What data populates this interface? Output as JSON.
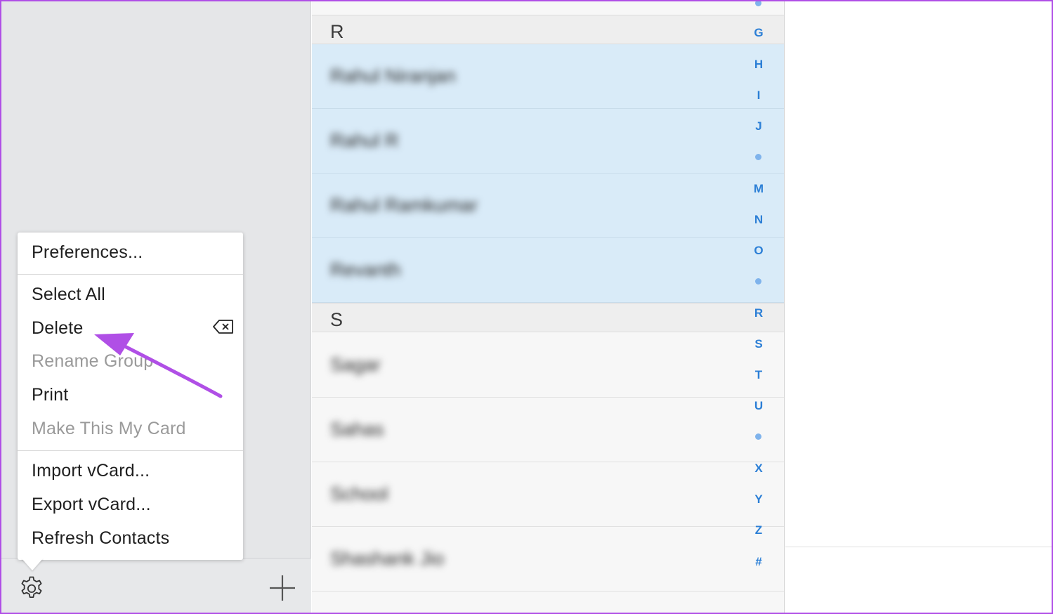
{
  "groups_pane": {
    "toolbar": {
      "settings_icon": "gear-icon",
      "add_icon": "plus-icon"
    }
  },
  "menu": {
    "items": [
      {
        "label": "Preferences...",
        "enabled": true
      },
      {
        "label": "Select All",
        "enabled": true
      },
      {
        "label": "Delete",
        "enabled": true,
        "shortcut_icon": "delete-key-icon"
      },
      {
        "label": "Rename Group",
        "enabled": false
      },
      {
        "label": "Print",
        "enabled": true
      },
      {
        "label": "Make This My Card",
        "enabled": false
      },
      {
        "label": "Import vCard...",
        "enabled": true
      },
      {
        "label": "Export vCard...",
        "enabled": true
      },
      {
        "label": "Refresh Contacts",
        "enabled": true
      }
    ]
  },
  "contacts": {
    "sections": [
      {
        "letter": "R",
        "rows": [
          {
            "name": "Rahul Niranjan",
            "selected": true
          },
          {
            "name": "Rahul R",
            "selected": true
          },
          {
            "name": "Rahul Ramkumar",
            "selected": true
          },
          {
            "name": "Revanth",
            "selected": true
          }
        ]
      },
      {
        "letter": "S",
        "rows": [
          {
            "name": "Sagar",
            "selected": false
          },
          {
            "name": "Sahas",
            "selected": false
          },
          {
            "name": "School",
            "selected": false
          },
          {
            "name": "Shashank Jio",
            "selected": false
          }
        ]
      }
    ],
    "index": [
      "G",
      "H",
      "I",
      "J",
      "•",
      "M",
      "N",
      "O",
      "•",
      "R",
      "S",
      "T",
      "U",
      "•",
      "X",
      "Y",
      "Z",
      "#"
    ]
  },
  "colors": {
    "accent": "#2c7fd6",
    "selection": "#d9ebf8",
    "annotation_arrow": "#b04fe6"
  }
}
